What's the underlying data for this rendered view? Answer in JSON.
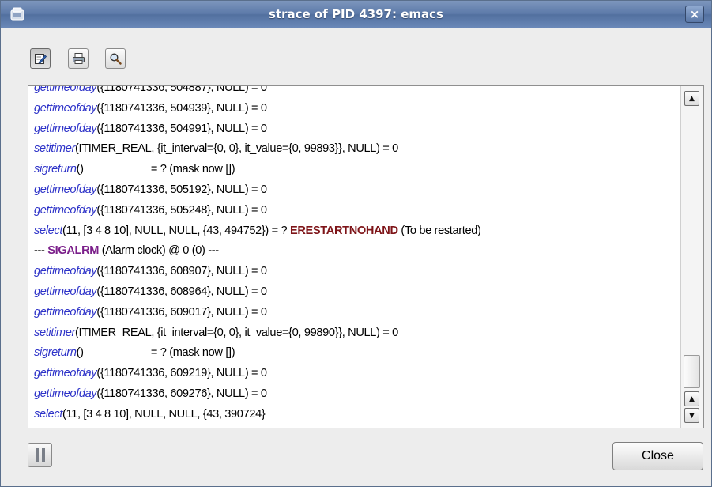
{
  "window": {
    "title": "strace of PID 4397: emacs",
    "close_glyph": "×"
  },
  "toolbar": {
    "buttons": [
      {
        "icon": "edit-icon"
      },
      {
        "icon": "print-icon"
      },
      {
        "icon": "search-icon"
      }
    ]
  },
  "trace": {
    "lines": [
      [
        {
          "t": "gettimeofday",
          "c": "fn"
        },
        {
          "t": "({1180741336, 504887}, NULL) = 0"
        }
      ],
      [
        {
          "t": "gettimeofday",
          "c": "fn"
        },
        {
          "t": "({1180741336, 504939}, NULL) = 0"
        }
      ],
      [
        {
          "t": "gettimeofday",
          "c": "fn"
        },
        {
          "t": "({1180741336, 504991}, NULL) = 0"
        }
      ],
      [
        {
          "t": "setitimer",
          "c": "fn"
        },
        {
          "t": "(ITIMER_REAL, {it_interval={0, 0}, it_value={0, 99893}}, NULL) = 0"
        }
      ],
      [
        {
          "t": "sigreturn",
          "c": "fn"
        },
        {
          "t": "()                       = ? (mask now [])"
        }
      ],
      [
        {
          "t": "gettimeofday",
          "c": "fn"
        },
        {
          "t": "({1180741336, 505192}, NULL) = 0"
        }
      ],
      [
        {
          "t": "gettimeofday",
          "c": "fn"
        },
        {
          "t": "({1180741336, 505248}, NULL) = 0"
        }
      ],
      [
        {
          "t": "select",
          "c": "fn"
        },
        {
          "t": "(11, [3 4 8 10], NULL, NULL, {43, 494752}) = ? "
        },
        {
          "t": "ERESTARTNOHAND",
          "c": "err"
        },
        {
          "t": " (To be restarted)"
        }
      ],
      [
        {
          "t": "--- "
        },
        {
          "t": "SIGALRM",
          "c": "sig"
        },
        {
          "t": " (Alarm clock) @ 0 (0) ---"
        }
      ],
      [
        {
          "t": "gettimeofday",
          "c": "fn"
        },
        {
          "t": "({1180741336, 608907}, NULL) = 0"
        }
      ],
      [
        {
          "t": "gettimeofday",
          "c": "fn"
        },
        {
          "t": "({1180741336, 608964}, NULL) = 0"
        }
      ],
      [
        {
          "t": "gettimeofday",
          "c": "fn"
        },
        {
          "t": "({1180741336, 609017}, NULL) = 0"
        }
      ],
      [
        {
          "t": "setitimer",
          "c": "fn"
        },
        {
          "t": "(ITIMER_REAL, {it_interval={0, 0}, it_value={0, 99890}}, NULL) = 0"
        }
      ],
      [
        {
          "t": "sigreturn",
          "c": "fn"
        },
        {
          "t": "()                       = ? (mask now [])"
        }
      ],
      [
        {
          "t": "gettimeofday",
          "c": "fn"
        },
        {
          "t": "({1180741336, 609219}, NULL) = 0"
        }
      ],
      [
        {
          "t": "gettimeofday",
          "c": "fn"
        },
        {
          "t": "({1180741336, 609276}, NULL) = 0"
        }
      ],
      [
        {
          "t": "select",
          "c": "fn"
        },
        {
          "t": "(11, [3 4 8 10], NULL, NULL, {43, 390724}"
        }
      ]
    ]
  },
  "scrollbar": {
    "up_glyph": "▲",
    "down_glyph": "▼"
  },
  "footer": {
    "close_label": "Close"
  },
  "colors": {
    "function": "#2d32c8",
    "error": "#7e1418",
    "signal": "#7b1f8a",
    "titlebar": "#5d7aa9"
  }
}
